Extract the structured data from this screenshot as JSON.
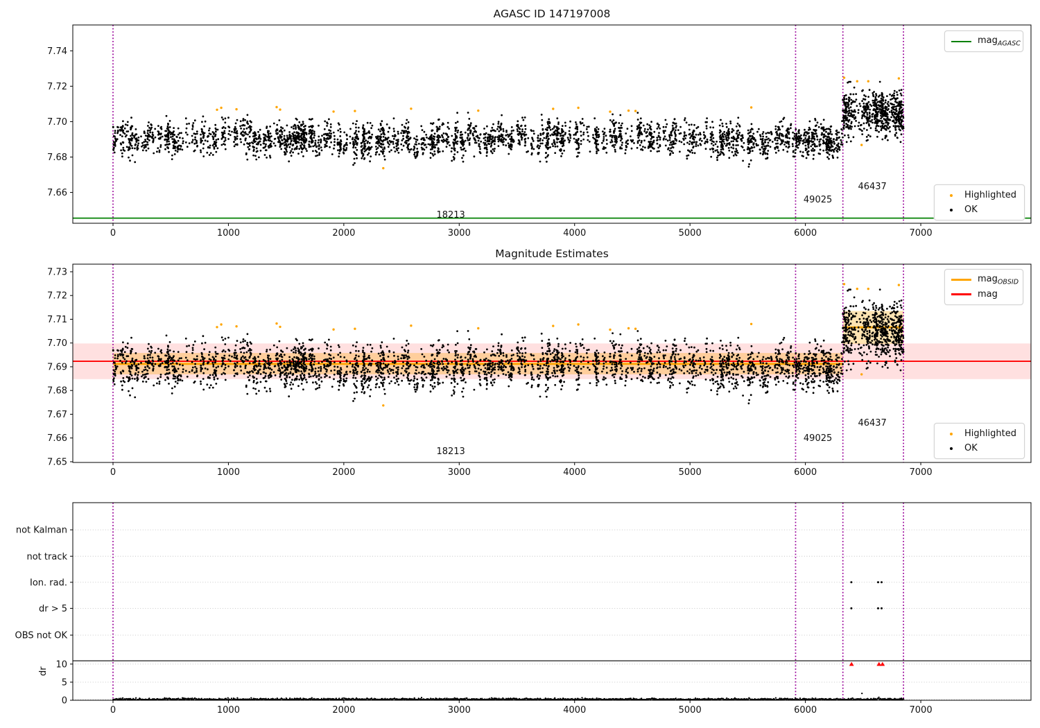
{
  "colors": {
    "green": "#008000",
    "red": "#ff0000",
    "orange": "#ffa500",
    "magenta": "#990099",
    "pink_band": "rgba(255,0,0,0.12)",
    "orange_band": "rgba(255,165,0,0.30)",
    "grid": "#c0c0c0",
    "black": "#000000"
  },
  "legends": {
    "mag_agasc": {
      "text": "mag",
      "sub": "AGASC"
    },
    "mag_obsid": {
      "text": "mag",
      "sub": "OBSID"
    },
    "mag": {
      "text": "mag"
    },
    "highlighted": "Highlighted",
    "ok": "OK"
  },
  "chart_data": [
    {
      "type": "scatter",
      "title": "AGASC ID 147197008",
      "xlim": [
        -348.5,
        7955
      ],
      "ylim": [
        7.6426,
        7.7546
      ],
      "x_ticks": [
        {
          "label": "0",
          "v": 0
        },
        {
          "label": "1000",
          "v": 1000
        },
        {
          "label": "2000",
          "v": 2000
        },
        {
          "label": "3000",
          "v": 3000
        },
        {
          "label": "4000",
          "v": 4000
        },
        {
          "label": "5000",
          "v": 5000
        },
        {
          "label": "6000",
          "v": 6000
        },
        {
          "label": "7000",
          "v": 7000
        }
      ],
      "y_ticks": [
        {
          "label": "7.66",
          "v": 7.66
        },
        {
          "label": "7.68",
          "v": 7.68
        },
        {
          "label": "7.70",
          "v": 7.7
        },
        {
          "label": "7.72",
          "v": 7.72
        },
        {
          "label": "7.74",
          "v": 7.74
        }
      ],
      "mag_agasc_line": 7.6455,
      "obsid_vlines": [
        0,
        5915,
        6325,
        6850
      ],
      "obsid_labels": [
        {
          "text": "18213",
          "x": 2927,
          "dy": 8
        },
        {
          "text": "49025",
          "x": 6108,
          "dy": 30
        },
        {
          "text": "46437",
          "x": 6580,
          "dy": 49
        }
      ],
      "scatter_model": {
        "seed": 20,
        "segments": [
          {
            "x0": 4,
            "x1": 5915,
            "mean": 7.6903,
            "base_spread": 0.0036,
            "std": 0.0042,
            "x_spread": 17,
            "cluster_gap": [
              10,
              58
            ],
            "cluster_size": [
              6,
              32
            ],
            "clip": [
              7.6738,
              7.7058
            ]
          },
          {
            "x0": 5915,
            "x1": 6325,
            "mean": 7.6908,
            "base_spread": 0.0036,
            "std": 0.0042,
            "x_spread": 17,
            "cluster_gap": [
              10,
              50
            ],
            "cluster_size": [
              6,
              30
            ],
            "clip": [
              7.6745,
              7.7055
            ]
          },
          {
            "x0": 6325,
            "x1": 6850,
            "mean": 7.7045,
            "base_spread": 0.0045,
            "std": 0.0055,
            "x_spread": 15,
            "cluster_gap": [
              8,
              36
            ],
            "cluster_size": [
              8,
              36
            ],
            "clip": [
              7.6885,
              7.7225
            ]
          }
        ]
      },
      "highlighted": [
        [
          901,
          7.7067
        ],
        [
          938,
          7.7078
        ],
        [
          1070,
          7.707
        ],
        [
          1418,
          7.7082
        ],
        [
          1448,
          7.7068
        ],
        [
          1911,
          7.7057
        ],
        [
          2096,
          7.706
        ],
        [
          2342,
          7.6737
        ],
        [
          2583,
          7.7073
        ],
        [
          3165,
          7.7062
        ],
        [
          3814,
          7.7072
        ],
        [
          4032,
          7.7078
        ],
        [
          4308,
          7.7056
        ],
        [
          4468,
          7.7062
        ],
        [
          4528,
          7.706
        ],
        [
          5531,
          7.708
        ],
        [
          6336,
          7.7248
        ],
        [
          6449,
          7.7228
        ],
        [
          6545,
          7.7228
        ],
        [
          6810,
          7.7244
        ],
        [
          6487,
          7.6868
        ]
      ]
    },
    {
      "type": "scatter",
      "title": "Magnitude Estimates",
      "xlim": [
        -348.5,
        7955
      ],
      "ylim": [
        7.6497,
        7.7332
      ],
      "x_ticks": [
        {
          "label": "0",
          "v": 0
        },
        {
          "label": "1000",
          "v": 1000
        },
        {
          "label": "2000",
          "v": 2000
        },
        {
          "label": "3000",
          "v": 3000
        },
        {
          "label": "4000",
          "v": 4000
        },
        {
          "label": "5000",
          "v": 5000
        },
        {
          "label": "6000",
          "v": 6000
        },
        {
          "label": "7000",
          "v": 7000
        }
      ],
      "y_ticks": [
        {
          "label": "7.65",
          "v": 7.65
        },
        {
          "label": "7.66",
          "v": 7.66
        },
        {
          "label": "7.67",
          "v": 7.67
        },
        {
          "label": "7.68",
          "v": 7.68
        },
        {
          "label": "7.69",
          "v": 7.69
        },
        {
          "label": "7.70",
          "v": 7.7
        },
        {
          "label": "7.71",
          "v": 7.71
        },
        {
          "label": "7.72",
          "v": 7.72
        },
        {
          "label": "7.73",
          "v": 7.73
        }
      ],
      "mag_line": 7.6923,
      "mag_band": [
        7.6848,
        7.6998
      ],
      "obsid_mags": [
        {
          "x0": 0,
          "x1": 6325,
          "mag": 7.6912,
          "band": [
            7.6868,
            7.6958
          ]
        },
        {
          "x0": 6325,
          "x1": 6850,
          "mag": 7.7066,
          "band": [
            7.6996,
            7.7135
          ]
        }
      ],
      "obsid_vlines": [
        0,
        5915,
        6325,
        6850
      ],
      "obsid_labels": [
        {
          "text": "18213",
          "x": 2927,
          "dy": 12
        },
        {
          "text": "49025",
          "x": 6108,
          "dy": 31
        },
        {
          "text": "46437",
          "x": 6580,
          "dy": 53
        }
      ]
    },
    {
      "type": "scatter",
      "title": "",
      "xlim": [
        -348.5,
        7955
      ],
      "ylim": [
        0,
        54.6
      ],
      "x_ticks": [
        {
          "label": "0",
          "v": 0
        },
        {
          "label": "1000",
          "v": 1000
        },
        {
          "label": "2000",
          "v": 2000
        },
        {
          "label": "3000",
          "v": 3000
        },
        {
          "label": "4000",
          "v": 4000
        },
        {
          "label": "5000",
          "v": 5000
        },
        {
          "label": "6000",
          "v": 6000
        },
        {
          "label": "7000",
          "v": 7000
        }
      ],
      "ylabel": "dr",
      "flag_rows": [
        {
          "label": "not Kalman",
          "v": 47.1,
          "x": []
        },
        {
          "label": "not track",
          "v": 39.8,
          "x": []
        },
        {
          "label": "Ion. rad.",
          "v": 32.6,
          "x": [
            6398,
            6630,
            6660
          ]
        },
        {
          "label": "dr > 5",
          "v": 25.4,
          "x": [
            6398,
            6630,
            6660
          ]
        },
        {
          "label": "OBS not OK",
          "v": 18.0,
          "x": []
        }
      ],
      "separator_v": 10.9,
      "dr_ticks": [
        {
          "label": "10",
          "v": 10
        },
        {
          "label": "5",
          "v": 5
        },
        {
          "label": "0",
          "v": 0
        }
      ],
      "dr_clipped_red": {
        "v": 10,
        "x": [
          6400,
          6638,
          6668
        ]
      },
      "dr_outlier": [
        6490,
        1.9
      ],
      "dr_series_model": {
        "seed": 7,
        "x0": 2,
        "x1": 6850,
        "step": [
          3,
          8
        ],
        "base": 0.12,
        "spread": 0.2,
        "max": 0.95
      },
      "obsid_vlines": [
        0,
        5915,
        6325,
        6850
      ]
    }
  ]
}
